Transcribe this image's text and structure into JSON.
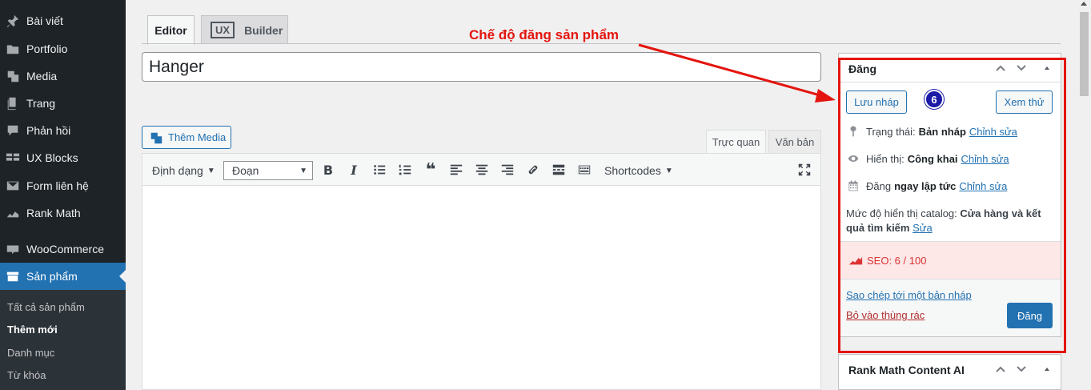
{
  "sidebar": {
    "items": [
      {
        "label": "Bài viết",
        "icon": "pin-icon"
      },
      {
        "label": "Portfolio",
        "icon": "folder-icon"
      },
      {
        "label": "Media",
        "icon": "media-icon"
      },
      {
        "label": "Trang",
        "icon": "page-icon"
      },
      {
        "label": "Phản hồi",
        "icon": "comment-icon"
      },
      {
        "label": "UX Blocks",
        "icon": "blocks-icon"
      },
      {
        "label": "Form liên hệ",
        "icon": "mail-icon"
      },
      {
        "label": "Rank Math",
        "icon": "chart-icon"
      },
      {
        "label": "WooCommerce",
        "icon": "woo-icon"
      },
      {
        "label": "Sản phẩm",
        "icon": "archive-icon",
        "active": true
      }
    ],
    "submenu": [
      "Tất cả sản phẩm",
      "Thêm mới",
      "Danh mục",
      "Từ khóa"
    ],
    "submenu_current": "Thêm mới"
  },
  "tabs": {
    "editor": "Editor",
    "ux": "UX",
    "builder": "Builder"
  },
  "title_value": "Hanger",
  "add_media_label": "Thêm Media",
  "modes": {
    "visual": "Trực quan",
    "text": "Văn bản"
  },
  "toolbar": {
    "format": "Định dạng",
    "paragraph": "Đoạn",
    "shortcodes": "Shortcodes"
  },
  "annotation": {
    "label": "Chế độ đăng sản phẩm",
    "badge": "6",
    "color": "#e3150e"
  },
  "publish": {
    "title": "Đăng",
    "save_draft": "Lưu nháp",
    "preview": "Xem thử",
    "status_label": "Trạng thái:",
    "status_value": "Bản nháp",
    "visibility_label": "Hiển thị:",
    "visibility_value": "Công khai",
    "schedule_label": "Đăng",
    "schedule_value": "ngay lập tức",
    "edit_link": "Chỉnh sửa",
    "catalog_label": "Mức độ hiển thị catalog:",
    "catalog_value": "Cửa hàng và kết quả tìm kiếm",
    "catalog_edit": "Sửa",
    "seo_label": "SEO: 6 / 100",
    "copy_draft": "Sao chép tới một bản nháp",
    "trash": "Bỏ vào thùng rác",
    "publish_btn": "Đăng"
  },
  "rankmath_box": {
    "title": "Rank Math Content AI"
  },
  "colors": {
    "sidebar": "#1d2327",
    "accent": "#2271b1",
    "seo_bg": "#fde7e7",
    "seo_text": "#dc3232"
  }
}
